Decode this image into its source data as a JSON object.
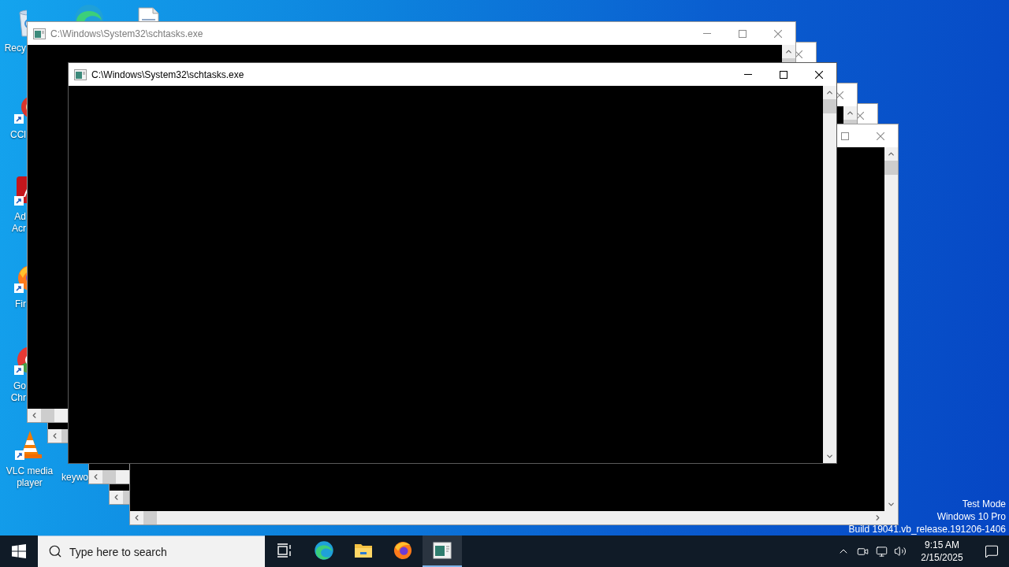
{
  "desktop": {
    "icons": [
      {
        "kind": "recycle-bin",
        "label": [
          "Recy"
        ]
      },
      {
        "kind": "edge"
      },
      {
        "kind": "document"
      },
      {
        "kind": "ccleaner",
        "label": [
          "CCl"
        ]
      },
      {
        "kind": "adobe",
        "label": [
          "Ad",
          "Acr"
        ]
      },
      {
        "kind": "firefox",
        "label": [
          "Fir"
        ]
      },
      {
        "kind": "chrome",
        "label": [
          "Go",
          "Chr"
        ]
      },
      {
        "kind": "vlc",
        "label": [
          "VLC media",
          "player"
        ]
      },
      {
        "label": [
          "keywo"
        ]
      }
    ],
    "system_text": [
      "Test Mode",
      "Windows 10 Pro",
      "Build 19041.vb_release.191206-1406"
    ]
  },
  "windows": [
    {
      "active": false,
      "buttons": [
        {
          "kind": "close"
        }
      ],
      "horizontal_scrollbar": true
    },
    {
      "active": false,
      "buttons": [
        {
          "kind": "close"
        }
      ],
      "horizontal_scrollbar": true
    },
    {
      "active": false,
      "buttons": [
        {
          "kind": "maximize"
        },
        {
          "kind": "close"
        }
      ],
      "horizontal_scrollbar": true
    },
    {
      "active": false,
      "buttons": [
        {
          "kind": "close"
        }
      ],
      "horizontal_scrollbar": true
    },
    {
      "title": "C:\\Windows\\System32\\schtasks.exe",
      "active": false,
      "buttons": [
        {
          "kind": "minimize"
        },
        {
          "kind": "maximize"
        },
        {
          "kind": "close"
        }
      ],
      "horizontal_scrollbar": true
    },
    {
      "title": "C:\\Windows\\System32\\schtasks.exe",
      "active": true,
      "buttons": [
        {
          "kind": "minimize"
        },
        {
          "kind": "maximize"
        },
        {
          "kind": "close"
        }
      ],
      "horizontal_scrollbar": false
    }
  ],
  "taskbar": {
    "search": {
      "placeholder": "Type here to search"
    },
    "apps": [
      {
        "kind": "task-view",
        "selected": false
      },
      {
        "kind": "edge",
        "selected": false
      },
      {
        "kind": "explorer",
        "selected": false
      },
      {
        "kind": "firefox",
        "selected": false
      },
      {
        "kind": "console",
        "selected": true
      }
    ],
    "clock": {
      "time": "9:15 AM",
      "date": "2/15/2025"
    }
  }
}
